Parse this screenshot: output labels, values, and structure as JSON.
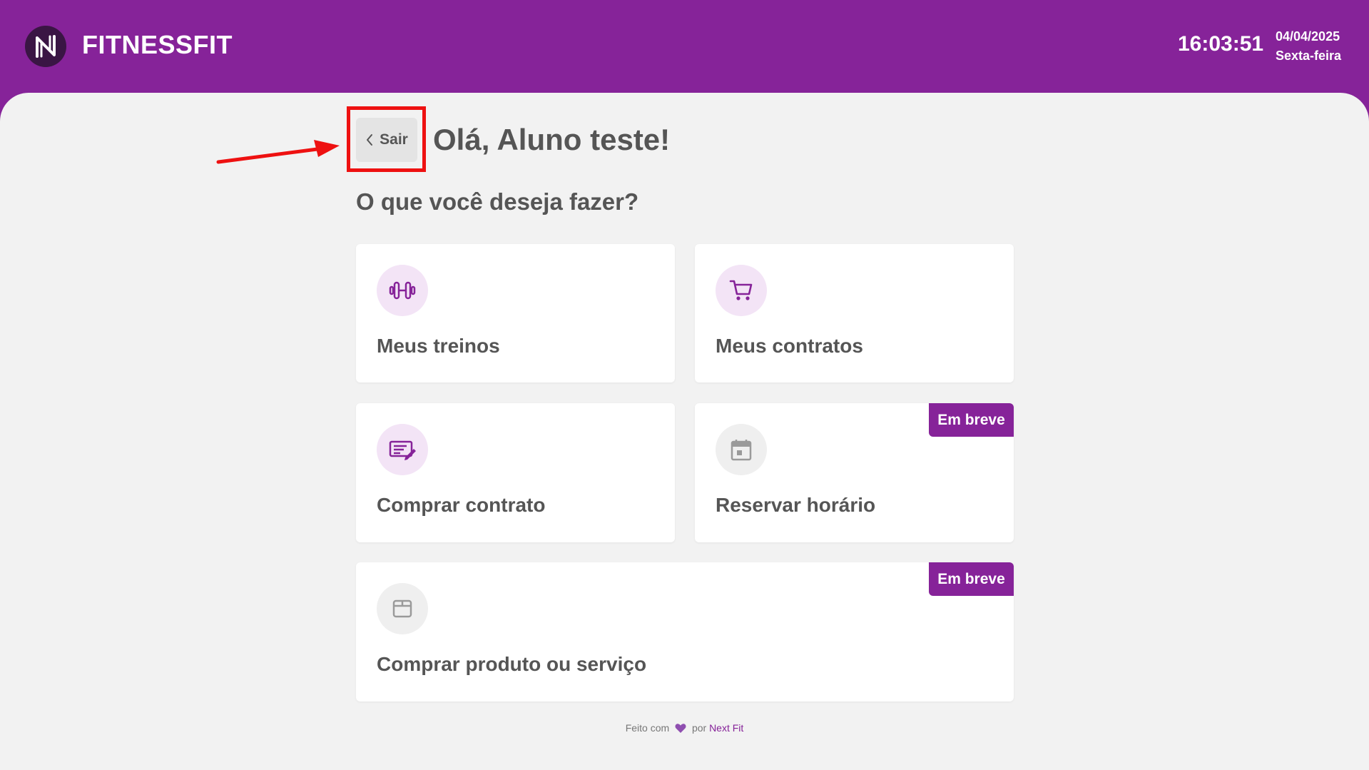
{
  "header": {
    "brand": "FITNESSFIT",
    "logo_icon": "next-fit-logo-icon",
    "time": "16:03:51",
    "date": "04/04/2025",
    "weekday": "Sexta-feira"
  },
  "colors": {
    "brand_purple": "#862399",
    "background": "#f2f2f2",
    "icon_bg_active": "#f3e4f6",
    "icon_bg_inactive": "#efefef",
    "annotation_red": "#ee1111"
  },
  "main": {
    "back_label": "Sair",
    "back_icon": "chevron-left-icon",
    "greeting": "Olá, Aluno teste!",
    "question": "O que você deseja fazer?"
  },
  "cards": [
    {
      "label": "Meus treinos",
      "icon": "dumbbell-icon",
      "badge": null
    },
    {
      "label": "Meus contratos",
      "icon": "cart-icon",
      "badge": null
    },
    {
      "label": "Comprar contrato",
      "icon": "edit-document-icon",
      "badge": null
    },
    {
      "label": "Reservar horário",
      "icon": "calendar-icon",
      "badge": "Em breve"
    },
    {
      "label": "Comprar produto ou serviço",
      "icon": "package-icon",
      "badge": "Em breve"
    }
  ],
  "footer": {
    "made_with": "Feito com",
    "by": "por",
    "brand_link": "Next Fit"
  }
}
